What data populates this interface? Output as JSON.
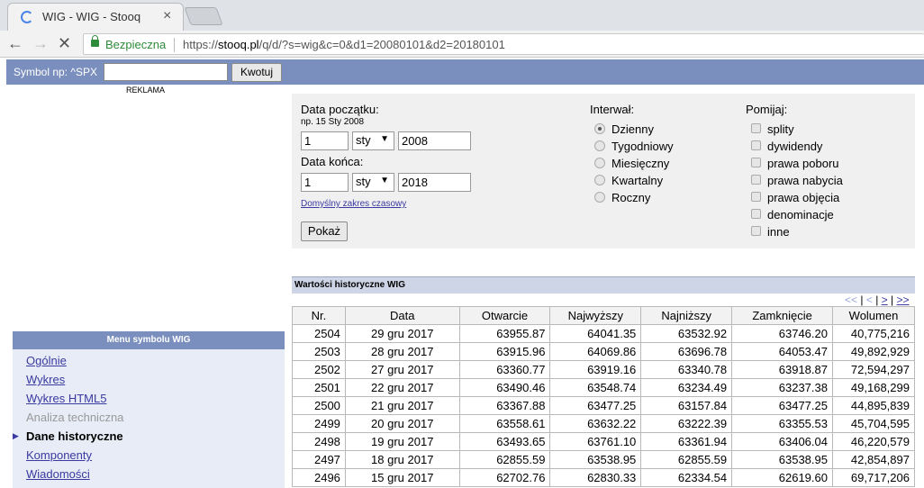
{
  "browser": {
    "tab_title": "WIG - WIG - Stooq",
    "secure_label": "Bezpieczna",
    "url_scheme": "https://",
    "url_host": "stooq.pl",
    "url_path": "/q/d/?s=wig&c=0&d1=20080101&d2=20180101"
  },
  "symbolbar": {
    "label": "Symbol np: ^SPX",
    "input_value": "",
    "button": "Kwotuj"
  },
  "reklama": "REKLAMA",
  "filters": {
    "start_label": "Data początku:",
    "start_hint": "np. 15 Sty 2008",
    "start_day": "1",
    "start_month": "sty",
    "start_year": "2008",
    "end_label": "Data końca:",
    "end_day": "1",
    "end_month": "sty",
    "end_year": "2018",
    "default_range_link": "Domyślny zakres czasowy",
    "show_button": "Pokaż",
    "interval_label": "Interwał:",
    "intervals": [
      "Dzienny",
      "Tygodniowy",
      "Miesięczny",
      "Kwartalny",
      "Roczny"
    ],
    "interval_selected": "Dzienny",
    "skip_label": "Pomijaj:",
    "skip_options": [
      "splity",
      "dywidendy",
      "prawa poboru",
      "prawa nabycia",
      "prawa objęcia",
      "denominacje",
      "inne"
    ]
  },
  "history": {
    "title": "Wartości historyczne WIG",
    "pager": {
      "first": "<<",
      "prev": "<",
      "next": ">",
      "last": ">>"
    },
    "columns": [
      "Nr.",
      "Data",
      "Otwarcie",
      "Najwyższy",
      "Najniższy",
      "Zamknięcie",
      "Wolumen"
    ],
    "rows": [
      [
        "2504",
        "29 gru 2017",
        "63955.87",
        "64041.35",
        "63532.92",
        "63746.20",
        "40,775,216"
      ],
      [
        "2503",
        "28 gru 2017",
        "63915.96",
        "64069.86",
        "63696.78",
        "64053.47",
        "49,892,929"
      ],
      [
        "2502",
        "27 gru 2017",
        "63360.77",
        "63919.16",
        "63340.78",
        "63918.87",
        "72,594,297"
      ],
      [
        "2501",
        "22 gru 2017",
        "63490.46",
        "63548.74",
        "63234.49",
        "63237.38",
        "49,168,299"
      ],
      [
        "2500",
        "21 gru 2017",
        "63367.88",
        "63477.25",
        "63157.84",
        "63477.25",
        "44,895,839"
      ],
      [
        "2499",
        "20 gru 2017",
        "63558.61",
        "63632.22",
        "63222.39",
        "63355.53",
        "45,704,595"
      ],
      [
        "2498",
        "19 gru 2017",
        "63493.65",
        "63761.10",
        "63361.94",
        "63406.04",
        "46,220,579"
      ],
      [
        "2497",
        "18 gru 2017",
        "62855.59",
        "63538.95",
        "62855.59",
        "63538.95",
        "42,854,897"
      ],
      [
        "2496",
        "15 gru 2017",
        "62702.76",
        "62830.33",
        "62334.54",
        "62619.60",
        "69,717,206"
      ]
    ]
  },
  "menu": {
    "title": "Menu symbolu WIG",
    "items": [
      {
        "label": "Ogólnie",
        "state": "link"
      },
      {
        "label": "Wykres",
        "state": "link"
      },
      {
        "label": "Wykres HTML5",
        "state": "link"
      },
      {
        "label": "Analiza techniczna",
        "state": "disabled"
      },
      {
        "label": "Dane historyczne",
        "state": "active"
      },
      {
        "label": "Komponenty",
        "state": "link"
      },
      {
        "label": "Wiadomości",
        "state": "link"
      }
    ]
  },
  "colors": {
    "header_blue": "#7b8fbe",
    "link": "#3a3aa0",
    "secure_green": "#2e8b3a"
  }
}
